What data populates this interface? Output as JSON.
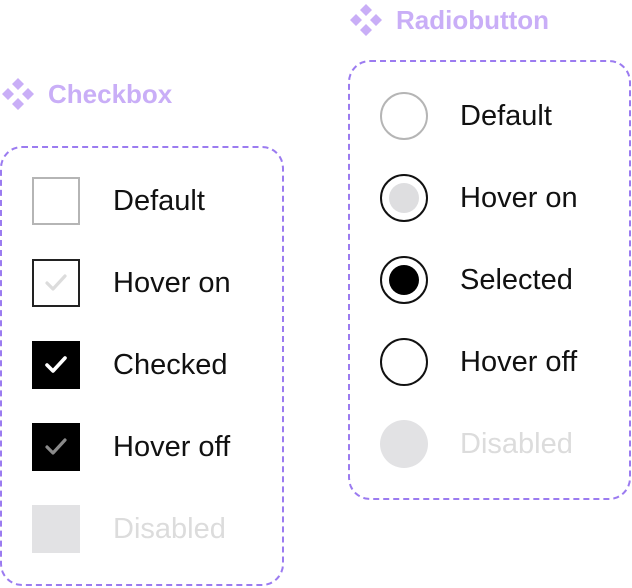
{
  "checkbox": {
    "title": "Checkbox",
    "icon": "component-diamond-icon",
    "states": [
      {
        "label": "Default",
        "state": "default",
        "checkmark": false
      },
      {
        "label": "Hover on",
        "state": "hover-on",
        "checkmark": true
      },
      {
        "label": "Checked",
        "state": "checked",
        "checkmark": true
      },
      {
        "label": "Hover off",
        "state": "hover-off",
        "checkmark": true
      },
      {
        "label": "Disabled",
        "state": "disabled",
        "checkmark": false
      }
    ]
  },
  "radiobutton": {
    "title": "Radiobutton",
    "icon": "component-diamond-icon",
    "states": [
      {
        "label": "Default",
        "state": "default"
      },
      {
        "label": "Hover on",
        "state": "hover-on"
      },
      {
        "label": "Selected",
        "state": "selected"
      },
      {
        "label": "Hover off",
        "state": "hover-off"
      },
      {
        "label": "Disabled",
        "state": "disabled"
      }
    ]
  },
  "colors": {
    "title_purple": "#c9aef7",
    "frame_dashed_border": "#9b7bf0",
    "checked_fill": "#000000",
    "disabled_fill": "#e2e2e4",
    "disabled_text": "#dcdcdc"
  }
}
